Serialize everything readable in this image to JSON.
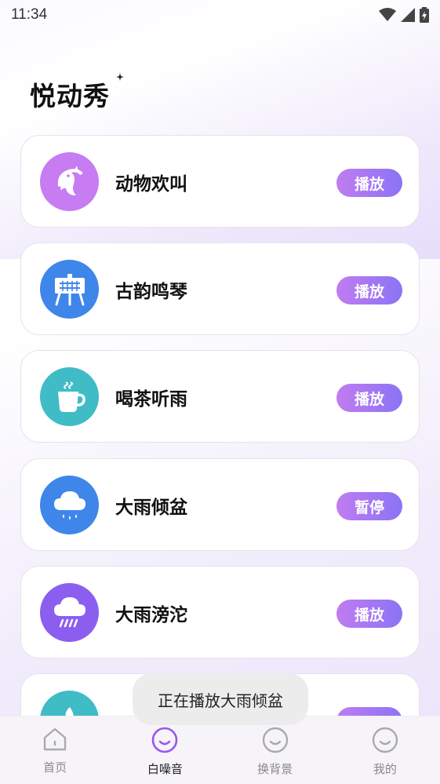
{
  "status_bar": {
    "time": "11:34"
  },
  "app": {
    "title": "悦动秀"
  },
  "items": [
    {
      "name": "动物欢叫",
      "button": "播放",
      "icon": "dolphin-icon",
      "color": "#c77cf2"
    },
    {
      "name": "古韵鸣琴",
      "button": "播放",
      "icon": "guqin-icon",
      "color": "#3f86ea"
    },
    {
      "name": "喝茶听雨",
      "button": "播放",
      "icon": "tea-cup-icon",
      "color": "#3fbcc6"
    },
    {
      "name": "大雨倾盆",
      "button": "暂停",
      "icon": "rain-cloud-icon",
      "color": "#3f86ea"
    },
    {
      "name": "大雨滂沱",
      "button": "播放",
      "icon": "storm-cloud-icon",
      "color": "#8b5ef0"
    },
    {
      "name": "",
      "button": "",
      "icon": "partial-icon",
      "color": "#3fbcc6"
    }
  ],
  "toast": {
    "text": "正在播放大雨倾盆"
  },
  "tabbar": {
    "tabs": [
      {
        "label": "首页"
      },
      {
        "label": "白噪音"
      },
      {
        "label": "换背景"
      },
      {
        "label": "我的"
      }
    ],
    "active_index": 1
  },
  "colors": {
    "accent_start": "#c07cf0",
    "accent_end": "#8b73f5"
  }
}
